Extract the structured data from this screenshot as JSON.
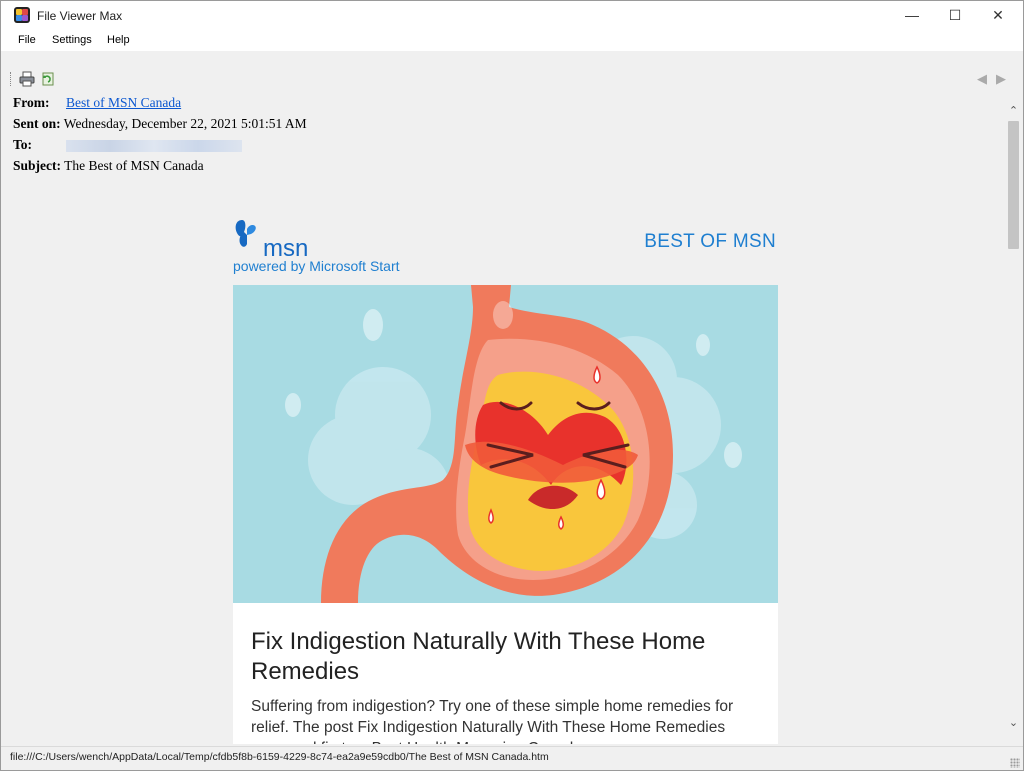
{
  "window": {
    "title": "File Viewer Max",
    "controls": {
      "minimize": "—",
      "maximize": "☐",
      "close": "✕"
    }
  },
  "menu": {
    "items": [
      "File",
      "Settings",
      "Help"
    ]
  },
  "toolbar": {
    "icons": [
      "printer-icon",
      "refresh-icon"
    ],
    "nav": {
      "back": "◀",
      "forward": "▶"
    }
  },
  "message": {
    "from_label": "From:",
    "from_value": "Best of MSN Canada",
    "sent_label": "Sent on:",
    "sent_value": "Wednesday, December 22, 2021 5:01:51 AM",
    "to_label": "To:",
    "subject_label": "Subject:",
    "subject_value": "The Best of MSN Canada"
  },
  "email_body": {
    "logo_text": "msn",
    "powered_by": "powered by Microsoft Start",
    "section_title": "BEST OF MSN",
    "article_title": "Fix Indigestion Naturally With These Home Remedies",
    "article_summary": "Suffering from indigestion? Try one of these simple home remedies for relief. The post Fix Indigestion Naturally With These Home Remedies appeared first on Best Health Magazine Canada.",
    "colors": {
      "brand_blue": "#1f7fd0",
      "hero_bg": "#a8dbe3",
      "stomach": "#f07a5c"
    }
  },
  "scrollbar": {
    "up": "⌃",
    "down": "⌄"
  },
  "status": {
    "path": "file:///C:/Users/wench/AppData/Local/Temp/cfdb5f8b-6159-4229-8c74-ea2a9e59cdb0/The Best of MSN Canada.htm"
  }
}
